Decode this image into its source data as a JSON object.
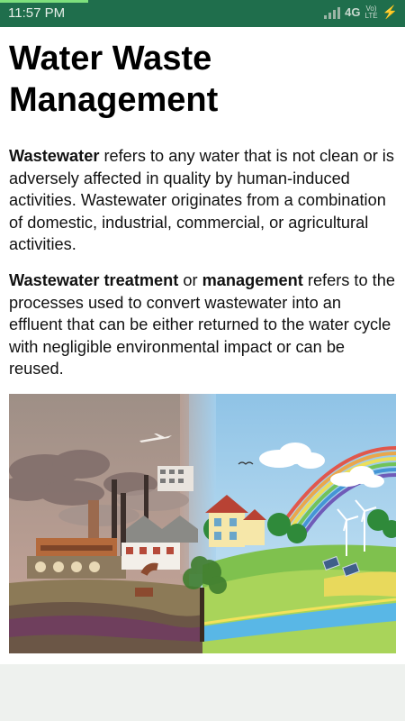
{
  "status_bar": {
    "time": "11:57 PM",
    "network": "4G",
    "volte_top": "Vo)",
    "volte_bottom": "LTE",
    "background": "#1f6e4c"
  },
  "article": {
    "title_line1": "Water Waste",
    "title_line2": "Management",
    "paragraph1": {
      "bold": "Wastewater",
      "text": " refers to any water that is not clean or is adversely affected in quality by human-induced activities. Wastewater originates from a combination of domestic, industrial, commercial, or agricultural activities."
    },
    "paragraph2": {
      "bold1": "Wastewater treatment",
      "mid": " or ",
      "bold2": "management",
      "text": " refers to the processes used to convert wastewater into an effluent that can be either returned to the water cycle with negligible environmental impact or can be reused."
    },
    "illustration": {
      "icon": "polluted-vs-clean-environment-illustration"
    }
  }
}
